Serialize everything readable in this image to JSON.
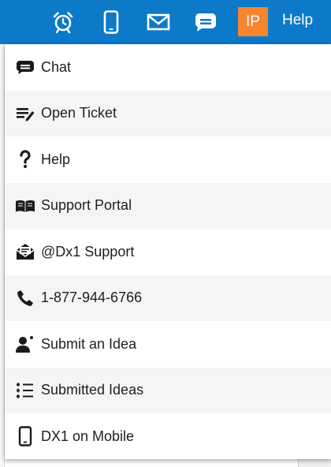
{
  "topbar": {
    "bg_color": "#0c7ac9",
    "icons": [
      "alarm-clock-icon",
      "mobile-phone-icon",
      "envelope-icon",
      "chat-bubble-icon"
    ],
    "avatar_initials": "IP",
    "avatar_color": "#f5852f",
    "help_label": "Help"
  },
  "menu": {
    "items": [
      {
        "label": "Chat",
        "icon": "chat-bubble-icon"
      },
      {
        "label": "Open Ticket",
        "icon": "ticket-pen-icon"
      },
      {
        "label": "Help",
        "icon": "question-mark-icon"
      },
      {
        "label": "Support Portal",
        "icon": "open-book-icon"
      },
      {
        "label": "@Dx1 Support",
        "icon": "envelope-open-icon"
      },
      {
        "label": "1-877-944-6766",
        "icon": "phone-icon"
      },
      {
        "label": "Submit an Idea",
        "icon": "user-idea-icon"
      },
      {
        "label": "Submitted Ideas",
        "icon": "list-icon"
      },
      {
        "label": "DX1 on Mobile",
        "icon": "mobile-phone-icon"
      }
    ]
  }
}
